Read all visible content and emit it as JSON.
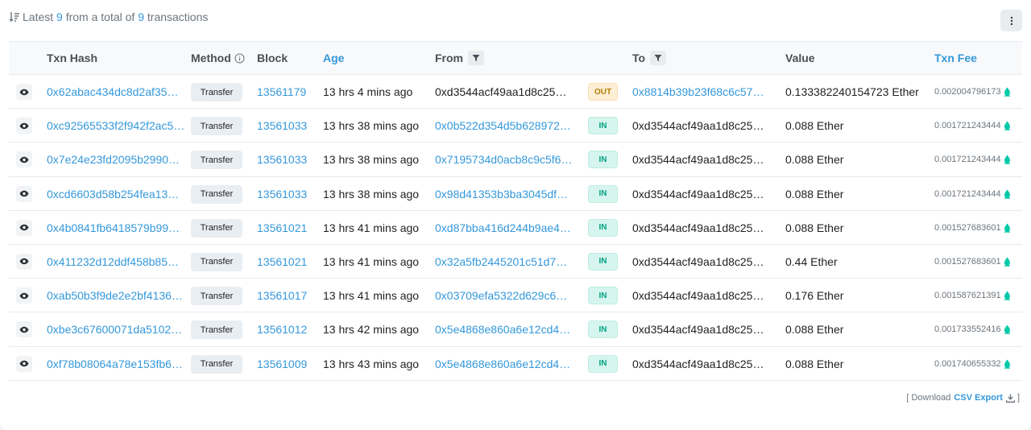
{
  "summary": {
    "prefix": "Latest",
    "count": "9",
    "middle": "from a total of",
    "total": "9",
    "suffix": "transactions"
  },
  "columns": {
    "txn_hash": "Txn Hash",
    "method": "Method",
    "block": "Block",
    "age": "Age",
    "from": "From",
    "to": "To",
    "value": "Value",
    "txn_fee": "Txn Fee"
  },
  "rows": [
    {
      "hash": "0x62abac434dc8d2af35…",
      "method": "Transfer",
      "block": "13561179",
      "age": "13 hrs 4 mins ago",
      "from": "0xd3544acf49aa1d8c25…",
      "dir": "OUT",
      "to": "0x8814b39b23f68c6c57…",
      "value": "0.133382240154723 Ether",
      "fee": "0.002004796173"
    },
    {
      "hash": "0xc92565533f2f942f2ac5…",
      "method": "Transfer",
      "block": "13561033",
      "age": "13 hrs 38 mins ago",
      "from": "0x0b522d354d5b628972…",
      "dir": "IN",
      "to": "0xd3544acf49aa1d8c25…",
      "value": "0.088 Ether",
      "fee": "0.001721243444"
    },
    {
      "hash": "0x7e24e23fd2095b2990…",
      "method": "Transfer",
      "block": "13561033",
      "age": "13 hrs 38 mins ago",
      "from": "0x7195734d0acb8c9c5f6…",
      "dir": "IN",
      "to": "0xd3544acf49aa1d8c25…",
      "value": "0.088 Ether",
      "fee": "0.001721243444"
    },
    {
      "hash": "0xcd6603d58b254fea13…",
      "method": "Transfer",
      "block": "13561033",
      "age": "13 hrs 38 mins ago",
      "from": "0x98d41353b3ba3045df…",
      "dir": "IN",
      "to": "0xd3544acf49aa1d8c25…",
      "value": "0.088 Ether",
      "fee": "0.001721243444"
    },
    {
      "hash": "0x4b0841fb6418579b99…",
      "method": "Transfer",
      "block": "13561021",
      "age": "13 hrs 41 mins ago",
      "from": "0xd87bba416d244b9ae4…",
      "dir": "IN",
      "to": "0xd3544acf49aa1d8c25…",
      "value": "0.088 Ether",
      "fee": "0.001527683601"
    },
    {
      "hash": "0x411232d12ddf458b85…",
      "method": "Transfer",
      "block": "13561021",
      "age": "13 hrs 41 mins ago",
      "from": "0x32a5fb2445201c51d7…",
      "dir": "IN",
      "to": "0xd3544acf49aa1d8c25…",
      "value": "0.44 Ether",
      "fee": "0.001527683601"
    },
    {
      "hash": "0xab50b3f9de2e2bf4136…",
      "method": "Transfer",
      "block": "13561017",
      "age": "13 hrs 41 mins ago",
      "from": "0x03709efa5322d629c6…",
      "dir": "IN",
      "to": "0xd3544acf49aa1d8c25…",
      "value": "0.176 Ether",
      "fee": "0.001587621391"
    },
    {
      "hash": "0xbe3c67600071da5102…",
      "method": "Transfer",
      "block": "13561012",
      "age": "13 hrs 42 mins ago",
      "from": "0x5e4868e860a6e12cd4…",
      "dir": "IN",
      "to": "0xd3544acf49aa1d8c25…",
      "value": "0.088 Ether",
      "fee": "0.001733552416"
    },
    {
      "hash": "0xf78b08064a78e153fb6…",
      "method": "Transfer",
      "block": "13561009",
      "age": "13 hrs 43 mins ago",
      "from": "0x5e4868e860a6e12cd4…",
      "dir": "IN",
      "to": "0xd3544acf49aa1d8c25…",
      "value": "0.088 Ether",
      "fee": "0.001740655332"
    }
  ],
  "footer": {
    "open": "[ Download",
    "csv": "CSV Export",
    "close": "]"
  },
  "icons": {
    "sort": "sort-icon",
    "more": "more-vertical-icon",
    "info": "info-icon",
    "filter": "filter-icon",
    "eye": "eye-icon",
    "gas": "gas-pump-icon",
    "download": "download-icon"
  },
  "colors": {
    "link": "#3498db",
    "in_badge_bg": "#d6f5ee",
    "in_badge_text": "#00a186",
    "out_badge_bg": "#fcefd6",
    "out_badge_text": "#b47d00",
    "gas_green": "#00c9a7"
  }
}
